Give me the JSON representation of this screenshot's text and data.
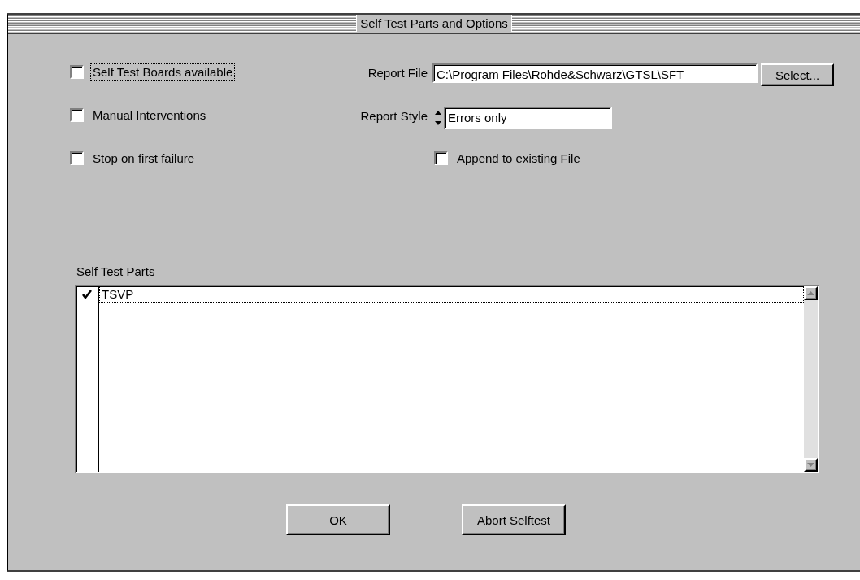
{
  "window": {
    "title": "Self Test Parts and Options"
  },
  "options": [
    {
      "label": "Self Test Boards available",
      "checked": false,
      "focused": true
    },
    {
      "label": "Manual Interventions",
      "checked": false,
      "focused": false
    },
    {
      "label": "Stop on first failure",
      "checked": false,
      "focused": false
    }
  ],
  "report_file": {
    "label": "Report File",
    "value": "C:\\Program Files\\Rohde&Schwarz\\GTSL\\SFT",
    "button": {
      "label": "Select..."
    }
  },
  "report_style": {
    "label": "Report Style",
    "value": "Errors only"
  },
  "append": {
    "label": "Append to existing File",
    "checked": false
  },
  "parts": {
    "label": "Self Test Parts",
    "items": [
      {
        "label": "TSVP",
        "checked": true,
        "focused": true
      }
    ]
  },
  "buttons": [
    {
      "label": "OK"
    },
    {
      "label": "Abort Selftest"
    }
  ]
}
